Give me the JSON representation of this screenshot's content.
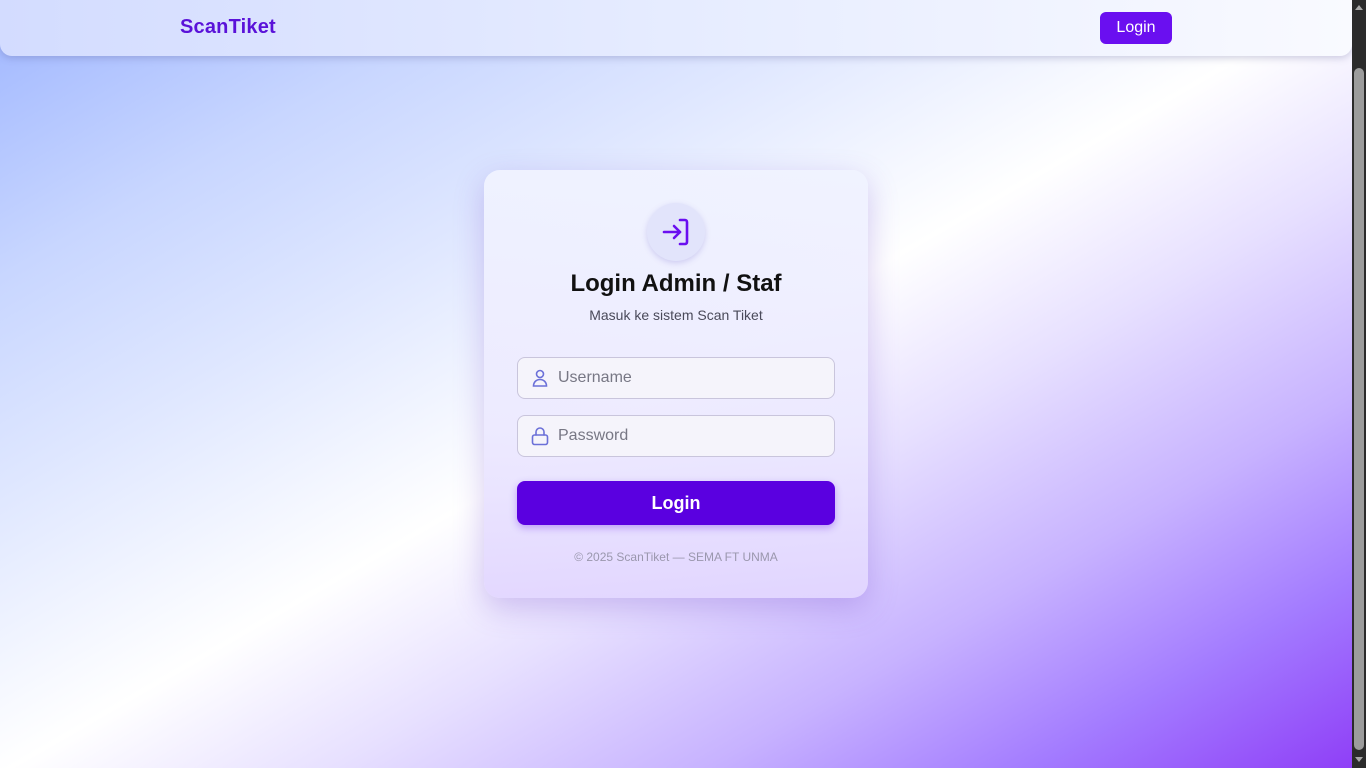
{
  "navbar": {
    "brand": "ScanTiket",
    "login_label": "Login"
  },
  "login_card": {
    "icon": "login-arrow-icon",
    "title": "Login Admin / Staf",
    "subtitle": "Masuk ke sistem Scan Tiket",
    "username": {
      "icon": "user-icon",
      "placeholder": "Username",
      "value": ""
    },
    "password": {
      "icon": "lock-icon",
      "placeholder": "Password",
      "value": ""
    },
    "submit_label": "Login",
    "footer": "© 2025 ScanTiket — SEMA FT UNMA"
  },
  "colors": {
    "accent": "#5a00e0",
    "brand": "#5a12d9",
    "nav_button": "#6a0ff0",
    "icon": "#6a0ff0",
    "field_icon": "#6b70d8"
  }
}
